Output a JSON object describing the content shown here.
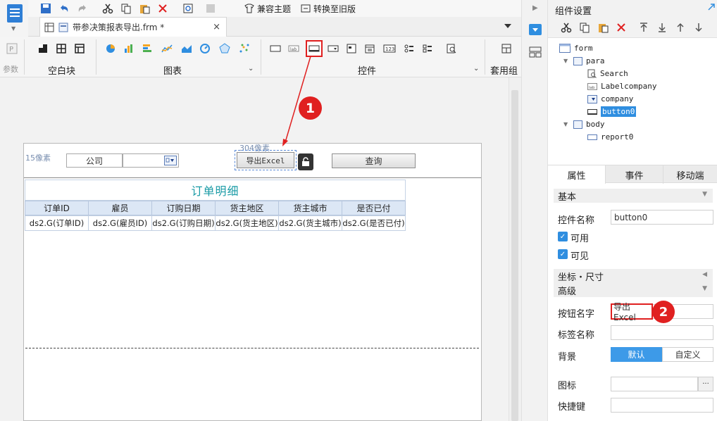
{
  "quickbar": {
    "compat_theme": "兼容主题",
    "switch_old": "转换至旧版"
  },
  "tab": {
    "filename": "带参决策报表导出.frm *",
    "close": "×"
  },
  "ribbon": {
    "param_label": "参数",
    "blank_label": "空白块",
    "chart_label": "图表",
    "widget_label": "控件",
    "preset_label": "套用组件"
  },
  "canvas": {
    "px15": "15像素",
    "px304": "304像素",
    "company_label": "公司",
    "export_button": "导出Excel",
    "query_button": "查询"
  },
  "report": {
    "title": "订单明细",
    "headers": [
      "订单ID",
      "雇员",
      "订购日期",
      "货主地区",
      "货主城市",
      "是否已付"
    ],
    "cells": [
      "ds2.G(订单ID)",
      "ds2.G(雇员ID)",
      "ds2.G(订购日期)",
      "ds2.G(货主地区)",
      "ds2.G(货主城市)",
      "ds2.G(是否已付)"
    ]
  },
  "callouts": {
    "one": "1",
    "two": "2"
  },
  "panel": {
    "title": "组件设置",
    "tree": {
      "form": "form",
      "para": "para",
      "search": "Search",
      "labelcompany": "Labelcompany",
      "company": "company",
      "button0": "button0",
      "body": "body",
      "report0": "report0"
    },
    "tabs": [
      "属性",
      "事件",
      "移动端"
    ],
    "sections": {
      "basic": "基本",
      "coords": "坐标・尺寸",
      "advanced": "高级"
    },
    "props": {
      "widget_name_label": "控件名称",
      "widget_name_value": "button0",
      "enabled_label": "可用",
      "visible_label": "可见",
      "button_name_label": "按钮名字",
      "button_name_value": "导出Excel",
      "tag_name_label": "标签名称",
      "background_label": "背景",
      "bg_default": "默认",
      "bg_custom": "自定义",
      "icon_label": "图标",
      "icon_more": "···",
      "hotkey_label": "快捷键"
    }
  },
  "colors": {
    "accent": "#2f8ee0",
    "callout_red": "#e02020",
    "title_teal": "#1a9ba6"
  }
}
